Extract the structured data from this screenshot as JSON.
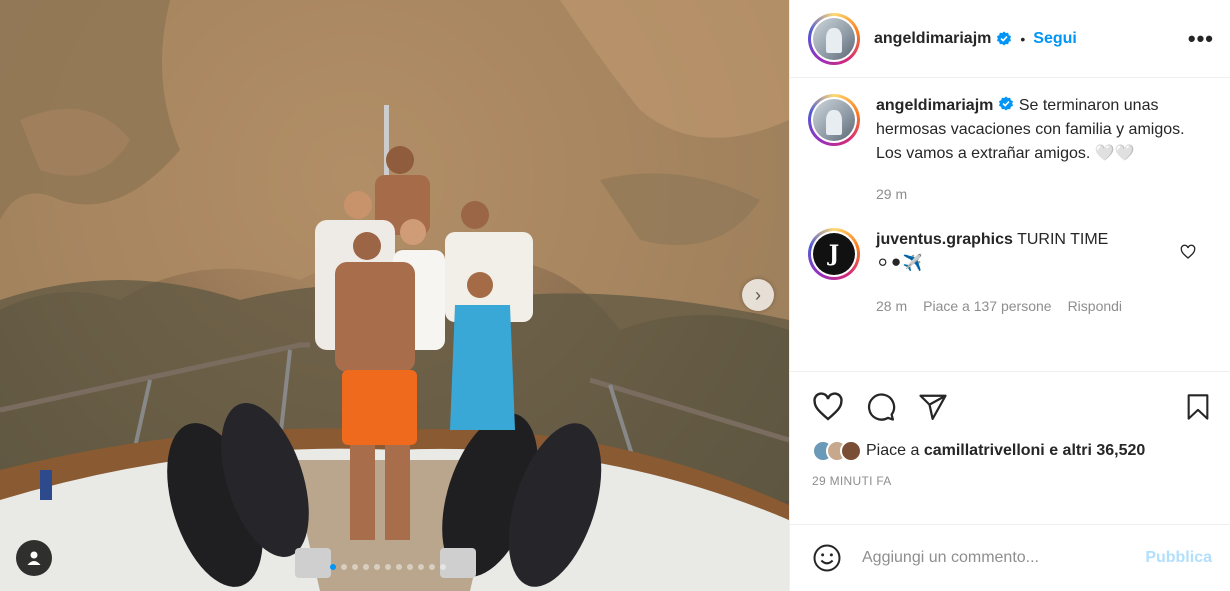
{
  "post": {
    "username": "angeldimariajm",
    "verified": true,
    "separator": "•",
    "follow_label": "Segui",
    "more_icon": "more-horizontal-icon",
    "carousel": {
      "slide_count": 11,
      "active_index": 0
    }
  },
  "caption": {
    "username": "angeldimariajm",
    "text": "Se terminaron unas hermosas vacaciones con familia y amigos. Los vamos a extrañar amigos. 🤍🤍",
    "time": "29 m"
  },
  "comments": [
    {
      "username": "juventus.graphics",
      "text": "TURIN TIME",
      "emojis": "⚪⚫✈️",
      "time": "28 m",
      "likes": "Piace a 137 persone",
      "reply": "Rispondi"
    }
  ],
  "actions": {
    "like_icon": "heart-icon",
    "comment_icon": "comment-icon",
    "share_icon": "send-icon",
    "save_icon": "bookmark-icon"
  },
  "likes": {
    "prefix": "Piace a ",
    "user": "camillatrivelloni",
    "suffix": " e altri 36,520"
  },
  "timestamp": "29 MINUTI FA",
  "composer": {
    "placeholder": "Aggiungi un commento...",
    "publish_label": "Pubblica",
    "emoji_icon": "emoji-icon"
  },
  "colors": {
    "accent": "#0095f6",
    "publish_disabled": "#b2dffc",
    "muted": "#8e8e8e"
  }
}
